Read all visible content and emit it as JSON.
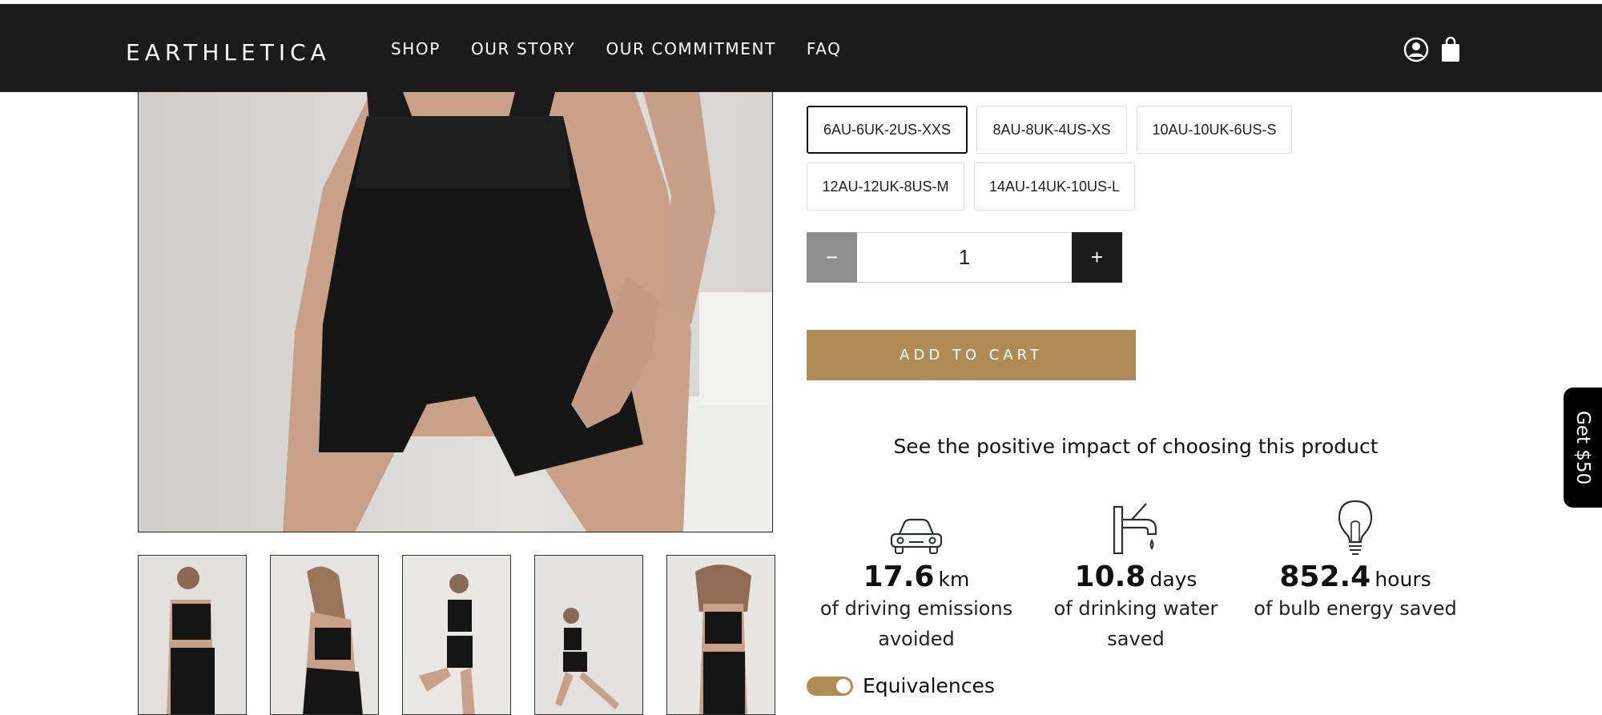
{
  "header": {
    "logo": "EARTHLETICA",
    "nav": [
      "SHOP",
      "OUR STORY",
      "OUR COMMITMENT",
      "FAQ"
    ],
    "icons": [
      "account-icon",
      "cart-icon"
    ]
  },
  "product": {
    "sizes": [
      {
        "label": "6AU-6UK-2US-XXS",
        "selected": true
      },
      {
        "label": "8AU-8UK-4US-XS",
        "selected": false
      },
      {
        "label": "10AU-10UK-6US-S",
        "selected": false
      },
      {
        "label": "12AU-12UK-8US-M",
        "selected": false
      },
      {
        "label": "14AU-14UK-10US-L",
        "selected": false
      }
    ],
    "quantity": "1",
    "minus_label": "−",
    "plus_label": "+",
    "add_to_cart": "ADD TO CART"
  },
  "impact": {
    "title": "See the positive impact of choosing this product",
    "items": [
      {
        "icon": "car-icon",
        "value": "17.6",
        "unit": "km",
        "desc": "of driving emissions avoided"
      },
      {
        "icon": "faucet-icon",
        "value": "10.8",
        "unit": "days",
        "desc": "of drinking water saved"
      },
      {
        "icon": "lightbulb-icon",
        "value": "852.4",
        "unit": "hours",
        "desc": "of bulb energy saved"
      }
    ],
    "toggle_label": "Equivalences",
    "toggle_on": true
  },
  "side_tab": "Get $50",
  "colors": {
    "header_bg": "#1b1b1b",
    "accent_gold": "#b18b55",
    "minus_bg": "#8f8f8f",
    "plus_bg": "#1b1b1b"
  }
}
